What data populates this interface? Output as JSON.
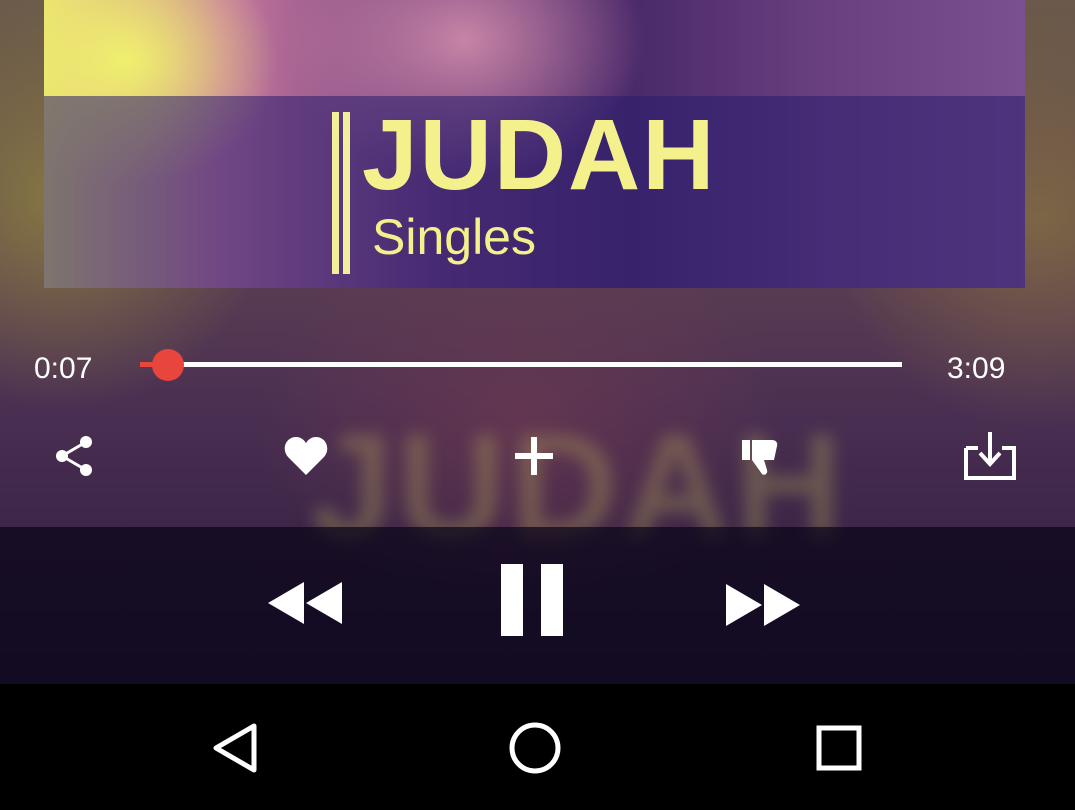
{
  "album_art": {
    "title": "JUDAH",
    "subtitle": "Singles"
  },
  "player": {
    "elapsed": "0:07",
    "duration": "3:09",
    "progress_fraction": 0.037
  },
  "actions": [
    {
      "icon": "share-icon"
    },
    {
      "icon": "heart-icon"
    },
    {
      "icon": "plus-icon"
    },
    {
      "icon": "thumbs-down-icon"
    },
    {
      "icon": "download-icon"
    }
  ],
  "transport": [
    {
      "icon": "rewind-icon"
    },
    {
      "icon": "pause-icon"
    },
    {
      "icon": "fast-forward-icon"
    }
  ],
  "navbar": [
    {
      "icon": "back-triangle-icon"
    },
    {
      "icon": "home-circle-icon"
    },
    {
      "icon": "recents-square-icon"
    }
  ],
  "colors": {
    "accent": "#e8453c",
    "art_text": "#f4f08c"
  }
}
